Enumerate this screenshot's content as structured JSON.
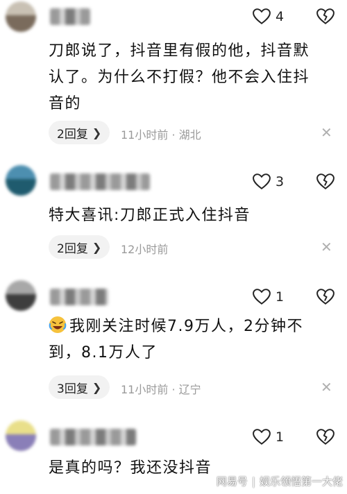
{
  "comments": [
    {
      "like_count": "4",
      "text_lines": [
        "刀郎说了，抖音里有假的他，抖音默",
        "认了。为什么不打假？他不会入住抖",
        "音的"
      ],
      "reply_label": "2回复",
      "time": "11小时前",
      "location": "湖北",
      "meta": "11小时前 · 湖北"
    },
    {
      "like_count": "3",
      "text_lines": [
        "特大喜讯:刀郎正式入住抖音"
      ],
      "reply_label": "2回复",
      "time": "12小时前",
      "meta": "12小时前"
    },
    {
      "like_count": "1",
      "text_lines": [
        "我刚关注时候7.9万人，2分钟不",
        "到，8.1万人了"
      ],
      "reply_label": "3回复",
      "time": "11小时前",
      "location": "辽宁",
      "meta": "11小时前 · 辽宁"
    },
    {
      "like_count": "1",
      "text_lines": [
        "是真的吗？我还没抖音"
      ]
    }
  ],
  "icons": {
    "like": "heart-outline-icon",
    "dislike": "broken-heart-icon",
    "close": "close-icon",
    "chevron": "chevron-right-icon",
    "emoji": "laughing-crying-emoji"
  },
  "watermark": {
    "left": "网易号",
    "right": "娱乐领悟第一大佬"
  },
  "colors": {
    "pill_bg": "#f2f2f2",
    "meta_gray": "#9a9a9a"
  }
}
